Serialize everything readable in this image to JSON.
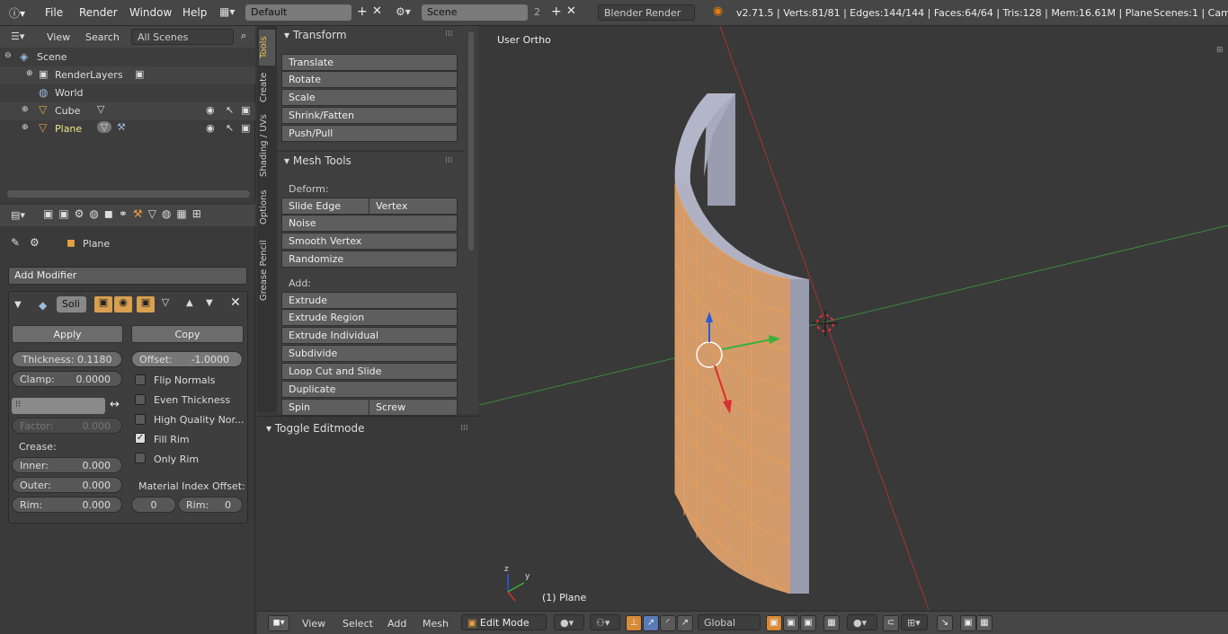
{
  "menu": {
    "file": "File",
    "render": "Render",
    "window": "Window",
    "help": "Help"
  },
  "layout": {
    "name": "Default",
    "scene": "Scene",
    "scene_count": "2",
    "engine": "Blender Render"
  },
  "stats": "v2.71.5 | Verts:81/81 | Edges:144/144 | Faces:64/64 | Tris:128 | Mem:16.61M | Plane",
  "scenes_info": "Scenes:1 | Came",
  "outliner": {
    "view": "View",
    "search": "Search",
    "filter": "All Scenes",
    "items": [
      "Scene",
      "RenderLayers",
      "World",
      "Cube",
      "Plane"
    ]
  },
  "props": {
    "object": "Plane",
    "add_modifier": "Add Modifier",
    "mod_name": "Soli",
    "apply": "Apply",
    "copy": "Copy",
    "thickness": "Thickness: 0.1180",
    "offset_label": "Offset:",
    "offset_val": "-1.0000",
    "clamp_label": "Clamp:",
    "clamp_val": "0.0000",
    "flip": "Flip Normals",
    "even": "Even Thickness",
    "hq": "High Quality Nor...",
    "fill": "Fill Rim",
    "only": "Only Rim",
    "factor_label": "Factor:",
    "factor_val": "0.000",
    "crease": "Crease:",
    "inner_label": "Inner:",
    "inner_val": "0.000",
    "outer_label": "Outer:",
    "outer_val": "0.000",
    "rim_label": "Rim:",
    "rim_val": "0.000",
    "mat_offset": "Material Index Offset:",
    "mat_val": "0",
    "mat_rim_label": "Rim:",
    "mat_rim_val": "0"
  },
  "tabs": [
    "Tools",
    "Create",
    "Shading / UVs",
    "Options",
    "Grease Pencil"
  ],
  "tools": {
    "transform": "Transform",
    "translate": "Translate",
    "rotate": "Rotate",
    "scale": "Scale",
    "shrink": "Shrink/Fatten",
    "push": "Push/Pull",
    "mesh_tools": "Mesh Tools",
    "deform": "Deform:",
    "slide_edge": "Slide Edge",
    "vertex": "Vertex",
    "noise": "Noise",
    "smooth": "Smooth Vertex",
    "randomize": "Randomize",
    "add": "Add:",
    "extrude": "Extrude",
    "extrude_region": "Extrude Region",
    "extrude_ind": "Extrude Individual",
    "subdivide": "Subdivide",
    "loopcut": "Loop Cut and Slide",
    "duplicate": "Duplicate",
    "spin": "Spin",
    "screw": "Screw",
    "toggle": "Toggle Editmode"
  },
  "viewport": {
    "view_name": "User Ortho",
    "obj_label": "(1) Plane",
    "axis_z": "z",
    "axis_y": "y"
  },
  "bottom": {
    "view": "View",
    "select": "Select",
    "add": "Add",
    "mesh": "Mesh",
    "mode": "Edit Mode",
    "orient": "Global"
  },
  "colors": {
    "accent": "#d88a36",
    "mesh_face": "#d39a6a",
    "mesh_side": "#9a9cb0"
  }
}
